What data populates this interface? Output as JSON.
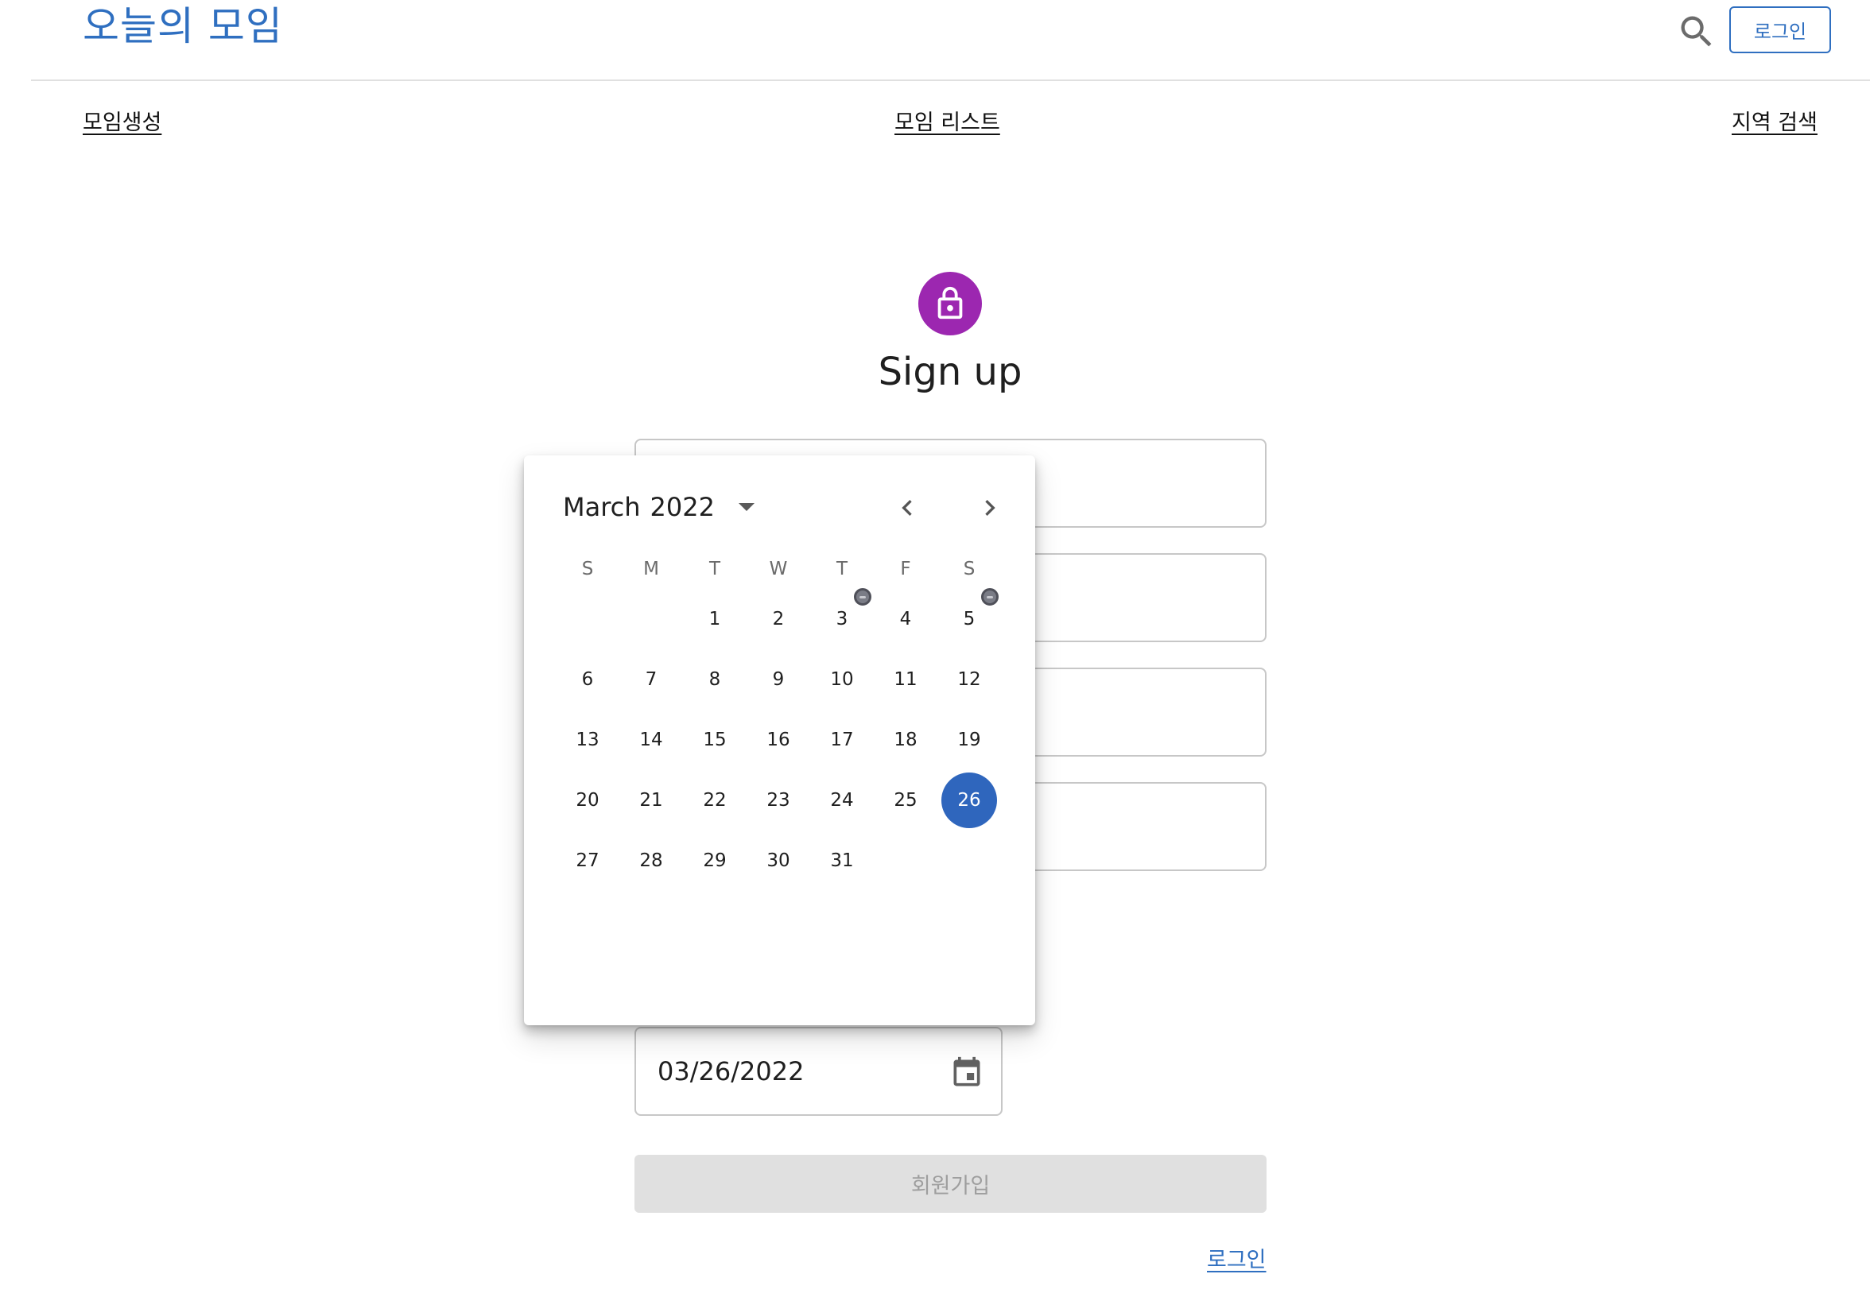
{
  "header": {
    "brand": "오늘의 모임",
    "login_button": "로그인",
    "search_icon": "search-icon"
  },
  "nav": {
    "create": "모임생성",
    "list": "모임 리스트",
    "region": "지역 검색"
  },
  "signup": {
    "title": "Sign up",
    "avatar_icon": "lock-icon",
    "avatar_color": "#9c27b0",
    "date_value": "03/26/2022",
    "date_icon": "calendar-icon",
    "submit_label": "회원가입",
    "login_link": "로그인"
  },
  "calendar": {
    "month_label": "March",
    "year_label": "2022",
    "weekdays": [
      "S",
      "M",
      "T",
      "W",
      "T",
      "F",
      "S"
    ],
    "first_weekday": 2,
    "days_in_month": 31,
    "selected_day": 26,
    "marked_days": [
      3,
      5
    ],
    "selected_color": "#2f66bd",
    "prev_icon": "chevron-left-icon",
    "next_icon": "chevron-right-icon"
  },
  "colors": {
    "brand": "#2f6fc0",
    "disabled_button": "#e0e0e0"
  }
}
